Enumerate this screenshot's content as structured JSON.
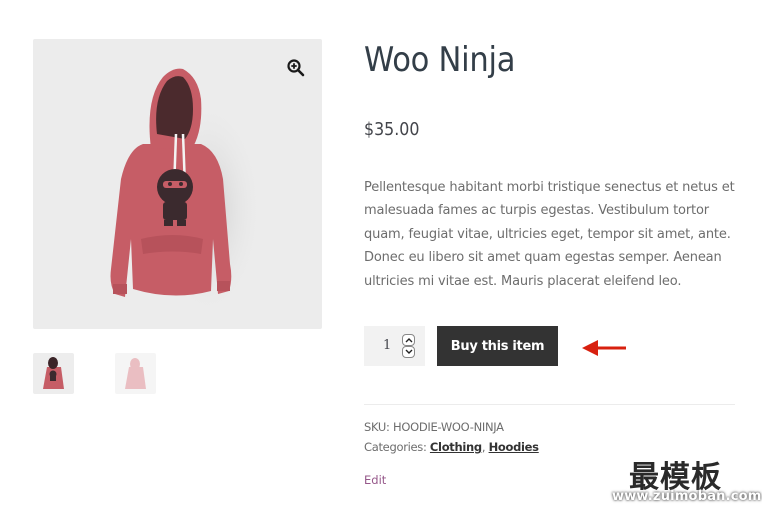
{
  "product": {
    "title": "Woo Ninja",
    "price": "$35.00",
    "description": "Pellentesque habitant morbi tristique senectus et netus et malesuada fames ac turpis egestas. Vestibulum tortor quam, feugiat vitae, ultricies eget, tempor sit amet, ante. Donec eu libero sit amet quam egestas semper. Aenean ultricies mi vitae est. Mauris placerat eleifend leo.",
    "image_alt": "Pink hoodie with ninja graphic",
    "thumbnails": [
      {
        "alt": "Hoodie front"
      },
      {
        "alt": "Hoodie back"
      }
    ]
  },
  "cart": {
    "quantity": "1",
    "buy_label": "Buy this item"
  },
  "meta": {
    "sku_label": "SKU:",
    "sku": "HOODIE-WOO-NINJA",
    "categories_label": "Categories:",
    "categories": [
      "Clothing",
      "Hoodies"
    ],
    "separator": ", ",
    "edit_label": "Edit"
  },
  "icons": {
    "zoom": "magnifier-plus-icon",
    "arrow": "arrow-left-icon"
  },
  "colors": {
    "button_bg": "#333333",
    "arrow": "#d8200f",
    "edit_link": "#96588a",
    "hoodie": "#c65d66"
  },
  "watermark": {
    "cn": "最模板",
    "url": "www.zuimoban.com"
  }
}
